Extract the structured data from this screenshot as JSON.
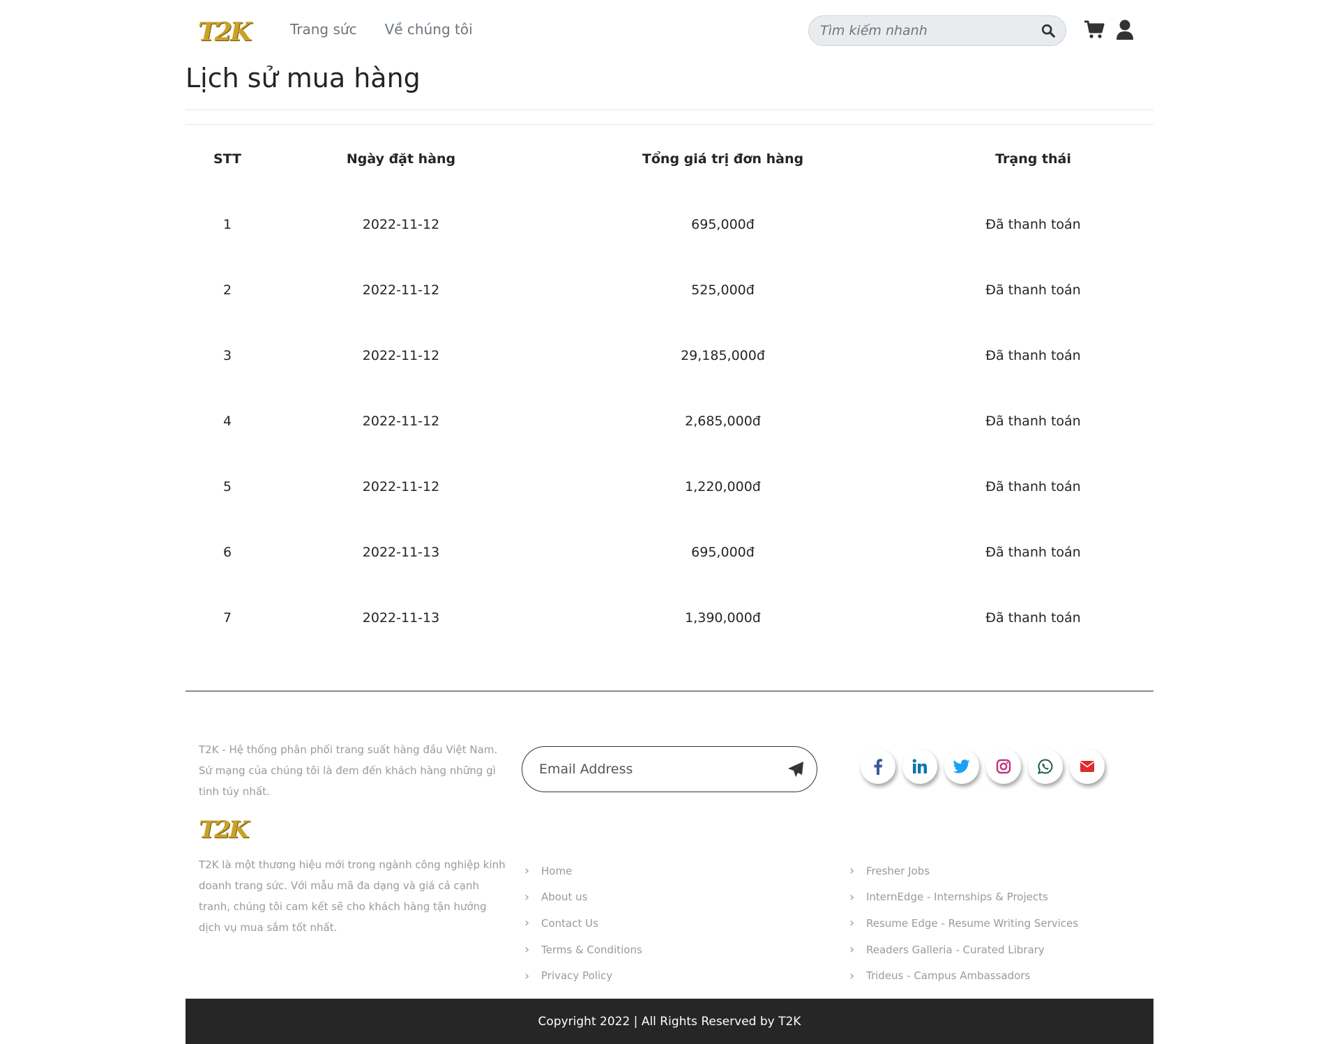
{
  "header": {
    "logo": "T2K",
    "nav": [
      "Trang sức",
      "Về chúng tôi"
    ],
    "search_placeholder": "Tìm kiếm nhanh"
  },
  "page_title": "Lịch sử mua hàng",
  "table": {
    "headers": [
      "STT",
      "Ngày đặt hàng",
      "Tổng giá trị đơn hàng",
      "Trạng thái"
    ],
    "rows": [
      [
        "1",
        "2022-11-12",
        "695,000đ",
        "Đã thanh toán"
      ],
      [
        "2",
        "2022-11-12",
        "525,000đ",
        "Đã thanh toán"
      ],
      [
        "3",
        "2022-11-12",
        "29,185,000đ",
        "Đã thanh toán"
      ],
      [
        "4",
        "2022-11-12",
        "2,685,000đ",
        "Đã thanh toán"
      ],
      [
        "5",
        "2022-11-12",
        "1,220,000đ",
        "Đã thanh toán"
      ],
      [
        "6",
        "2022-11-13",
        "695,000đ",
        "Đã thanh toán"
      ],
      [
        "7",
        "2022-11-13",
        "1,390,000đ",
        "Đã thanh toán"
      ]
    ]
  },
  "footer": {
    "about_short": "T2K - Hệ thống phân phối trang suất hàng đầu Việt Nam. Sứ mạng của chúng tôi là đem đến khách hàng những gì tinh túy nhất.",
    "logo": "T2K",
    "about_long": "T2K là một thương hiệu mới trong ngành công nghiệp kinh doanh trang sức. Với mẫu mã đa dạng và giá cả cạnh tranh, chúng tôi cam kết sẽ cho khách hàng tận hưởng dịch vụ mua sắm tốt nhất.",
    "email_placeholder": "Email Address",
    "socials": [
      {
        "icon": "facebook-icon",
        "color": "#3b5998"
      },
      {
        "icon": "linkedin-icon",
        "color": "#0e76a8"
      },
      {
        "icon": "twitter-icon",
        "color": "#1da1f2"
      },
      {
        "icon": "instagram-icon",
        "color": "#c13584"
      },
      {
        "icon": "whatsapp-icon",
        "color": "#1e5b3a"
      },
      {
        "icon": "email-icon",
        "color": "#dd2c2c"
      }
    ],
    "links_col1": [
      "Home",
      "About us",
      "Contact Us",
      "Terms & Conditions",
      "Privacy Policy"
    ],
    "links_col2": [
      "Fresher Jobs",
      "InternEdge - Internships & Projects",
      "Resume Edge - Resume Writing Services",
      "Readers Galleria - Curated Library",
      "Trideus - Campus Ambassadors"
    ],
    "copyright": "Copyright 2022 | All Rights Reserved by T2K"
  }
}
